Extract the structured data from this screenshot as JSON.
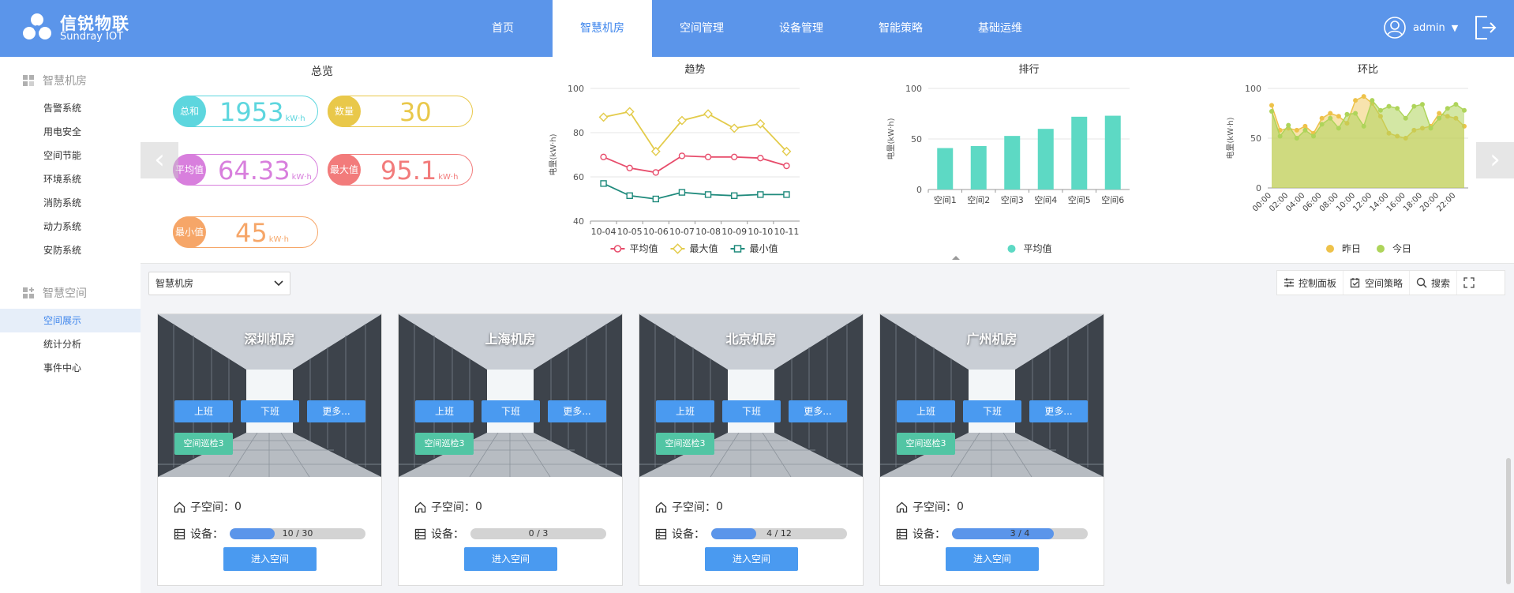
{
  "brand": {
    "name_cn": "信锐物联",
    "name_en": "Sundray IOT"
  },
  "nav": {
    "items": [
      {
        "label": "首页",
        "active": false
      },
      {
        "label": "智慧机房",
        "active": true
      },
      {
        "label": "空间管理",
        "active": false
      },
      {
        "label": "设备管理",
        "active": false
      },
      {
        "label": "智能策略",
        "active": false
      },
      {
        "label": "基础运维",
        "active": false
      }
    ]
  },
  "user": {
    "name": "admin"
  },
  "sidebar": {
    "section1": {
      "title": "智慧机房",
      "items": [
        "告警系统",
        "用电安全",
        "空间节能",
        "环境系统",
        "消防系统",
        "动力系统",
        "安防系统"
      ]
    },
    "section2": {
      "title": "智慧空间",
      "items": [
        "空间展示",
        "统计分析",
        "事件中心"
      ],
      "active_index": 0
    }
  },
  "overview": {
    "title": "总览",
    "unit": "kW·h",
    "total": {
      "label": "总和",
      "value": "1953"
    },
    "count": {
      "label": "数量",
      "value": "30"
    },
    "avg": {
      "label": "平均值",
      "value": "64.33"
    },
    "max": {
      "label": "最大值",
      "value": "95.1"
    },
    "min": {
      "label": "最小值",
      "value": "45"
    }
  },
  "colors": {
    "accent": "#5b95ea",
    "teal": "#52c5a4",
    "cyan": "#5dd6de",
    "yellow": "#e9c84a",
    "purple": "#d87fdd",
    "red": "#f27b7b",
    "orange": "#f6a668"
  },
  "chart_data": [
    {
      "type": "line",
      "title": "趋势",
      "ylabel": "电量(kW·h)",
      "ylim": [
        40,
        100
      ],
      "yticks": [
        40,
        60,
        80,
        100
      ],
      "categories": [
        "10-04",
        "10-05",
        "10-06",
        "10-07",
        "10-08",
        "10-09",
        "10-10",
        "10-11"
      ],
      "series": [
        {
          "name": "平均值",
          "color": "#e74c6b",
          "values": [
            69,
            64,
            62,
            69.5,
            69,
            69,
            68.5,
            65
          ]
        },
        {
          "name": "最大值",
          "color": "#e3cb4a",
          "values": [
            87,
            89.5,
            71.5,
            85.5,
            88.5,
            82,
            84,
            71.5
          ]
        },
        {
          "name": "最小值",
          "color": "#1f8a7c",
          "values": [
            57,
            51.5,
            50,
            53,
            52,
            51.5,
            52,
            52
          ]
        }
      ],
      "legend": "bottom"
    },
    {
      "type": "bar",
      "title": "排行",
      "ylabel": "电量(kW·h)",
      "ylim": [
        0,
        100
      ],
      "yticks": [
        0,
        50,
        100
      ],
      "categories": [
        "空间1",
        "空间2",
        "空间3",
        "空间4",
        "空间5",
        "空间6"
      ],
      "series": [
        {
          "name": "平均值",
          "color": "#5dd9c4",
          "values": [
            41,
            43,
            53,
            60,
            72,
            73
          ]
        }
      ],
      "legend": "bottom"
    },
    {
      "type": "area",
      "title": "环比",
      "ylabel": "电量(kW·h)",
      "ylim": [
        0,
        100
      ],
      "yticks": [
        0,
        50,
        100
      ],
      "categories": [
        "00:00",
        "01:00",
        "02:00",
        "03:00",
        "04:00",
        "05:00",
        "06:00",
        "07:00",
        "08:00",
        "09:00",
        "10:00",
        "11:00",
        "12:00",
        "13:00",
        "14:00",
        "15:00",
        "16:00",
        "17:00",
        "18:00",
        "19:00",
        "20:00",
        "21:00",
        "22:00",
        "23:00"
      ],
      "xtick_labels": [
        "00:00",
        "02:00",
        "04:00",
        "06:00",
        "08:00",
        "10:00",
        "12:00",
        "14:00",
        "16:00",
        "18:00",
        "20:00",
        "22:00"
      ],
      "series": [
        {
          "name": "昨日",
          "color": "#eec24a",
          "values": [
            83,
            58,
            60,
            58,
            62,
            55,
            70,
            75,
            72,
            65,
            88,
            92,
            85,
            72,
            55,
            52,
            50,
            58,
            60,
            62,
            75,
            72,
            70,
            62
          ]
        },
        {
          "name": "今日",
          "color": "#aed45a",
          "values": [
            77,
            52,
            63,
            50,
            58,
            52,
            64,
            70,
            60,
            74,
            75,
            62,
            88,
            78,
            82,
            80,
            70,
            82,
            84,
            60,
            70,
            80,
            84,
            78
          ]
        }
      ],
      "legend": "bottom"
    }
  ],
  "toolbar": {
    "select_value": "智慧机房",
    "tools": [
      "控制面板",
      "空间策略",
      "搜索"
    ]
  },
  "rooms": [
    {
      "name": "深圳机房",
      "on": "上班",
      "off": "下班",
      "more": "更多...",
      "tag": "空间巡检3",
      "sub_label": "子空间：",
      "sub_count": "0",
      "dev_label": "设备：",
      "dev_text": "10 / 30",
      "dev_ratio": 0.333,
      "enter": "进入空间"
    },
    {
      "name": "上海机房",
      "on": "上班",
      "off": "下班",
      "more": "更多...",
      "tag": "空间巡检3",
      "sub_label": "子空间：",
      "sub_count": "0",
      "dev_label": "设备：",
      "dev_text": "0 / 3",
      "dev_ratio": 0,
      "enter": "进入空间"
    },
    {
      "name": "北京机房",
      "on": "上班",
      "off": "下班",
      "more": "更多...",
      "tag": "空间巡检3",
      "sub_label": "子空间：",
      "sub_count": "0",
      "dev_label": "设备：",
      "dev_text": "4 / 12",
      "dev_ratio": 0.333,
      "enter": "进入空间"
    },
    {
      "name": "广州机房",
      "on": "上班",
      "off": "下班",
      "more": "更多...",
      "tag": "空间巡检3",
      "sub_label": "子空间：",
      "sub_count": "0",
      "dev_label": "设备：",
      "dev_text": "3 / 4",
      "dev_ratio": 0.75,
      "enter": "进入空间"
    }
  ]
}
